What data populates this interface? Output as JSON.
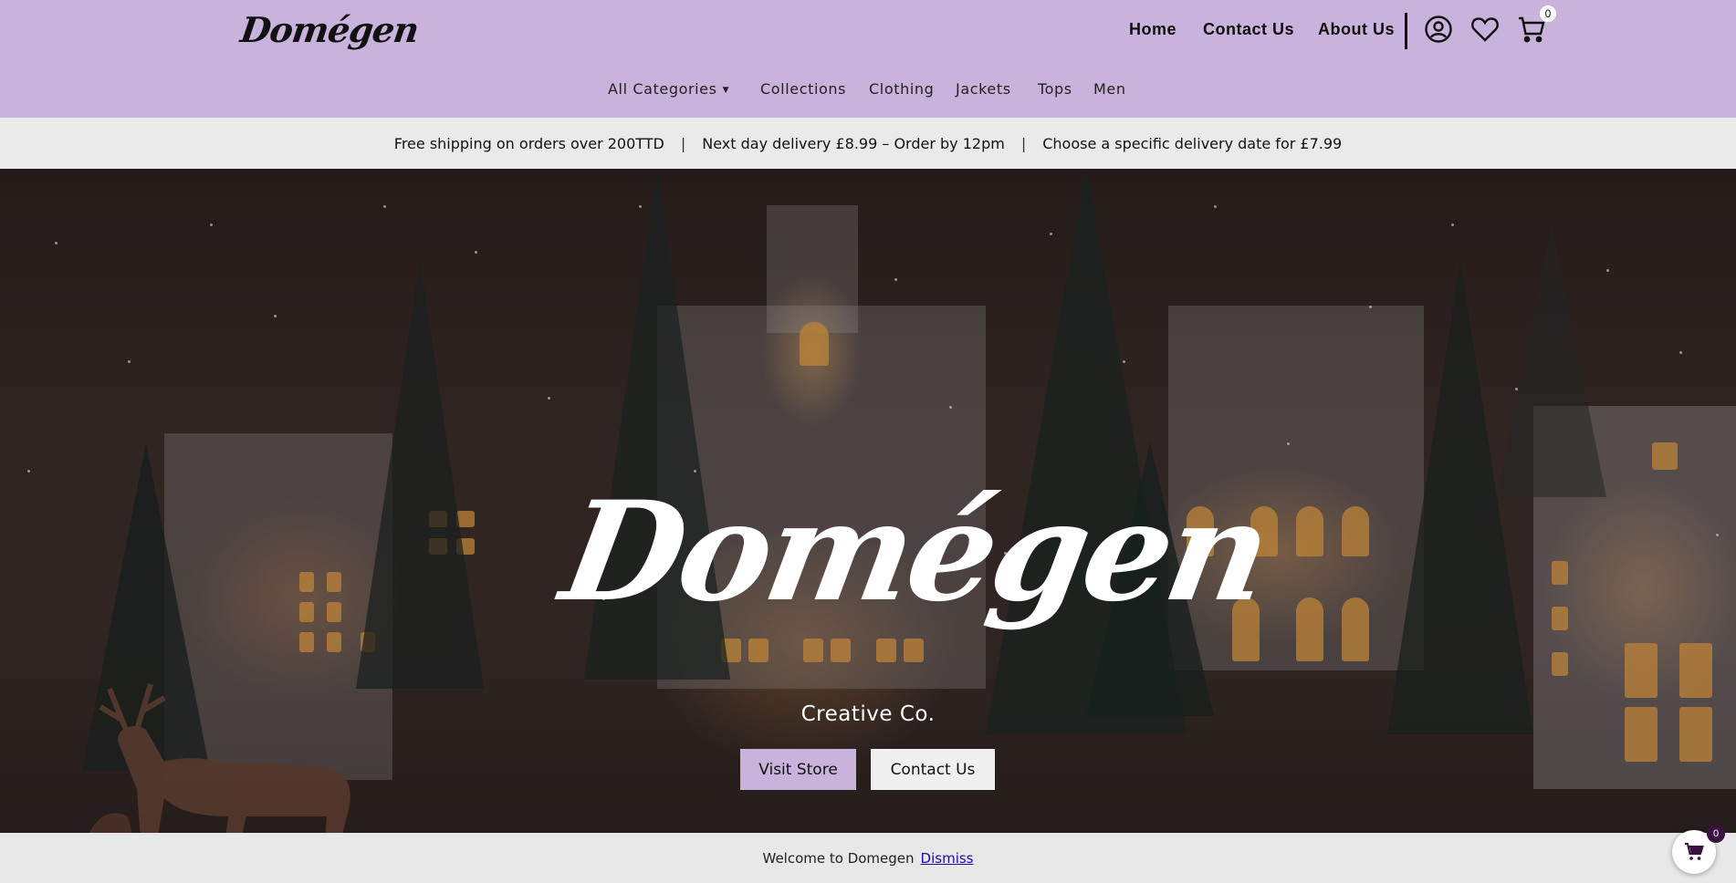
{
  "brand": {
    "logo_text": "Domégen"
  },
  "topnav": {
    "home": "Home",
    "contact": "Contact Us",
    "about": "About Us",
    "cart_count": "0"
  },
  "icons": {
    "account": "account-icon",
    "wishlist": "heart-icon",
    "cart": "cart-icon",
    "caret": "caret-down-icon"
  },
  "categories": {
    "all": "All Categories",
    "caret": "▼",
    "collections": "Collections",
    "clothing": "Clothing",
    "jackets": "Jackets",
    "tops": "Tops",
    "men": "Men"
  },
  "promo": {
    "item1": "Free shipping on orders over 200TTD",
    "item2": "Next day delivery £8.99 – Order by 12pm",
    "item3": "Choose a specific delivery date for £7.99",
    "separator": "|"
  },
  "hero": {
    "title": "Domégen",
    "subtitle": "Creative Co.",
    "visit_button": "Visit Store",
    "contact_button": "Contact Us"
  },
  "notice": {
    "text": "Welcome to Domegen",
    "dismiss": "Dismiss"
  },
  "floating_cart": {
    "count": "0"
  },
  "colors": {
    "header_bg": "#c9b3dc",
    "promo_bg": "#eaeaea",
    "accent_button": "#c9b3dc",
    "notice_bg": "#e8e8e8",
    "float_badge": "#3c1142"
  }
}
